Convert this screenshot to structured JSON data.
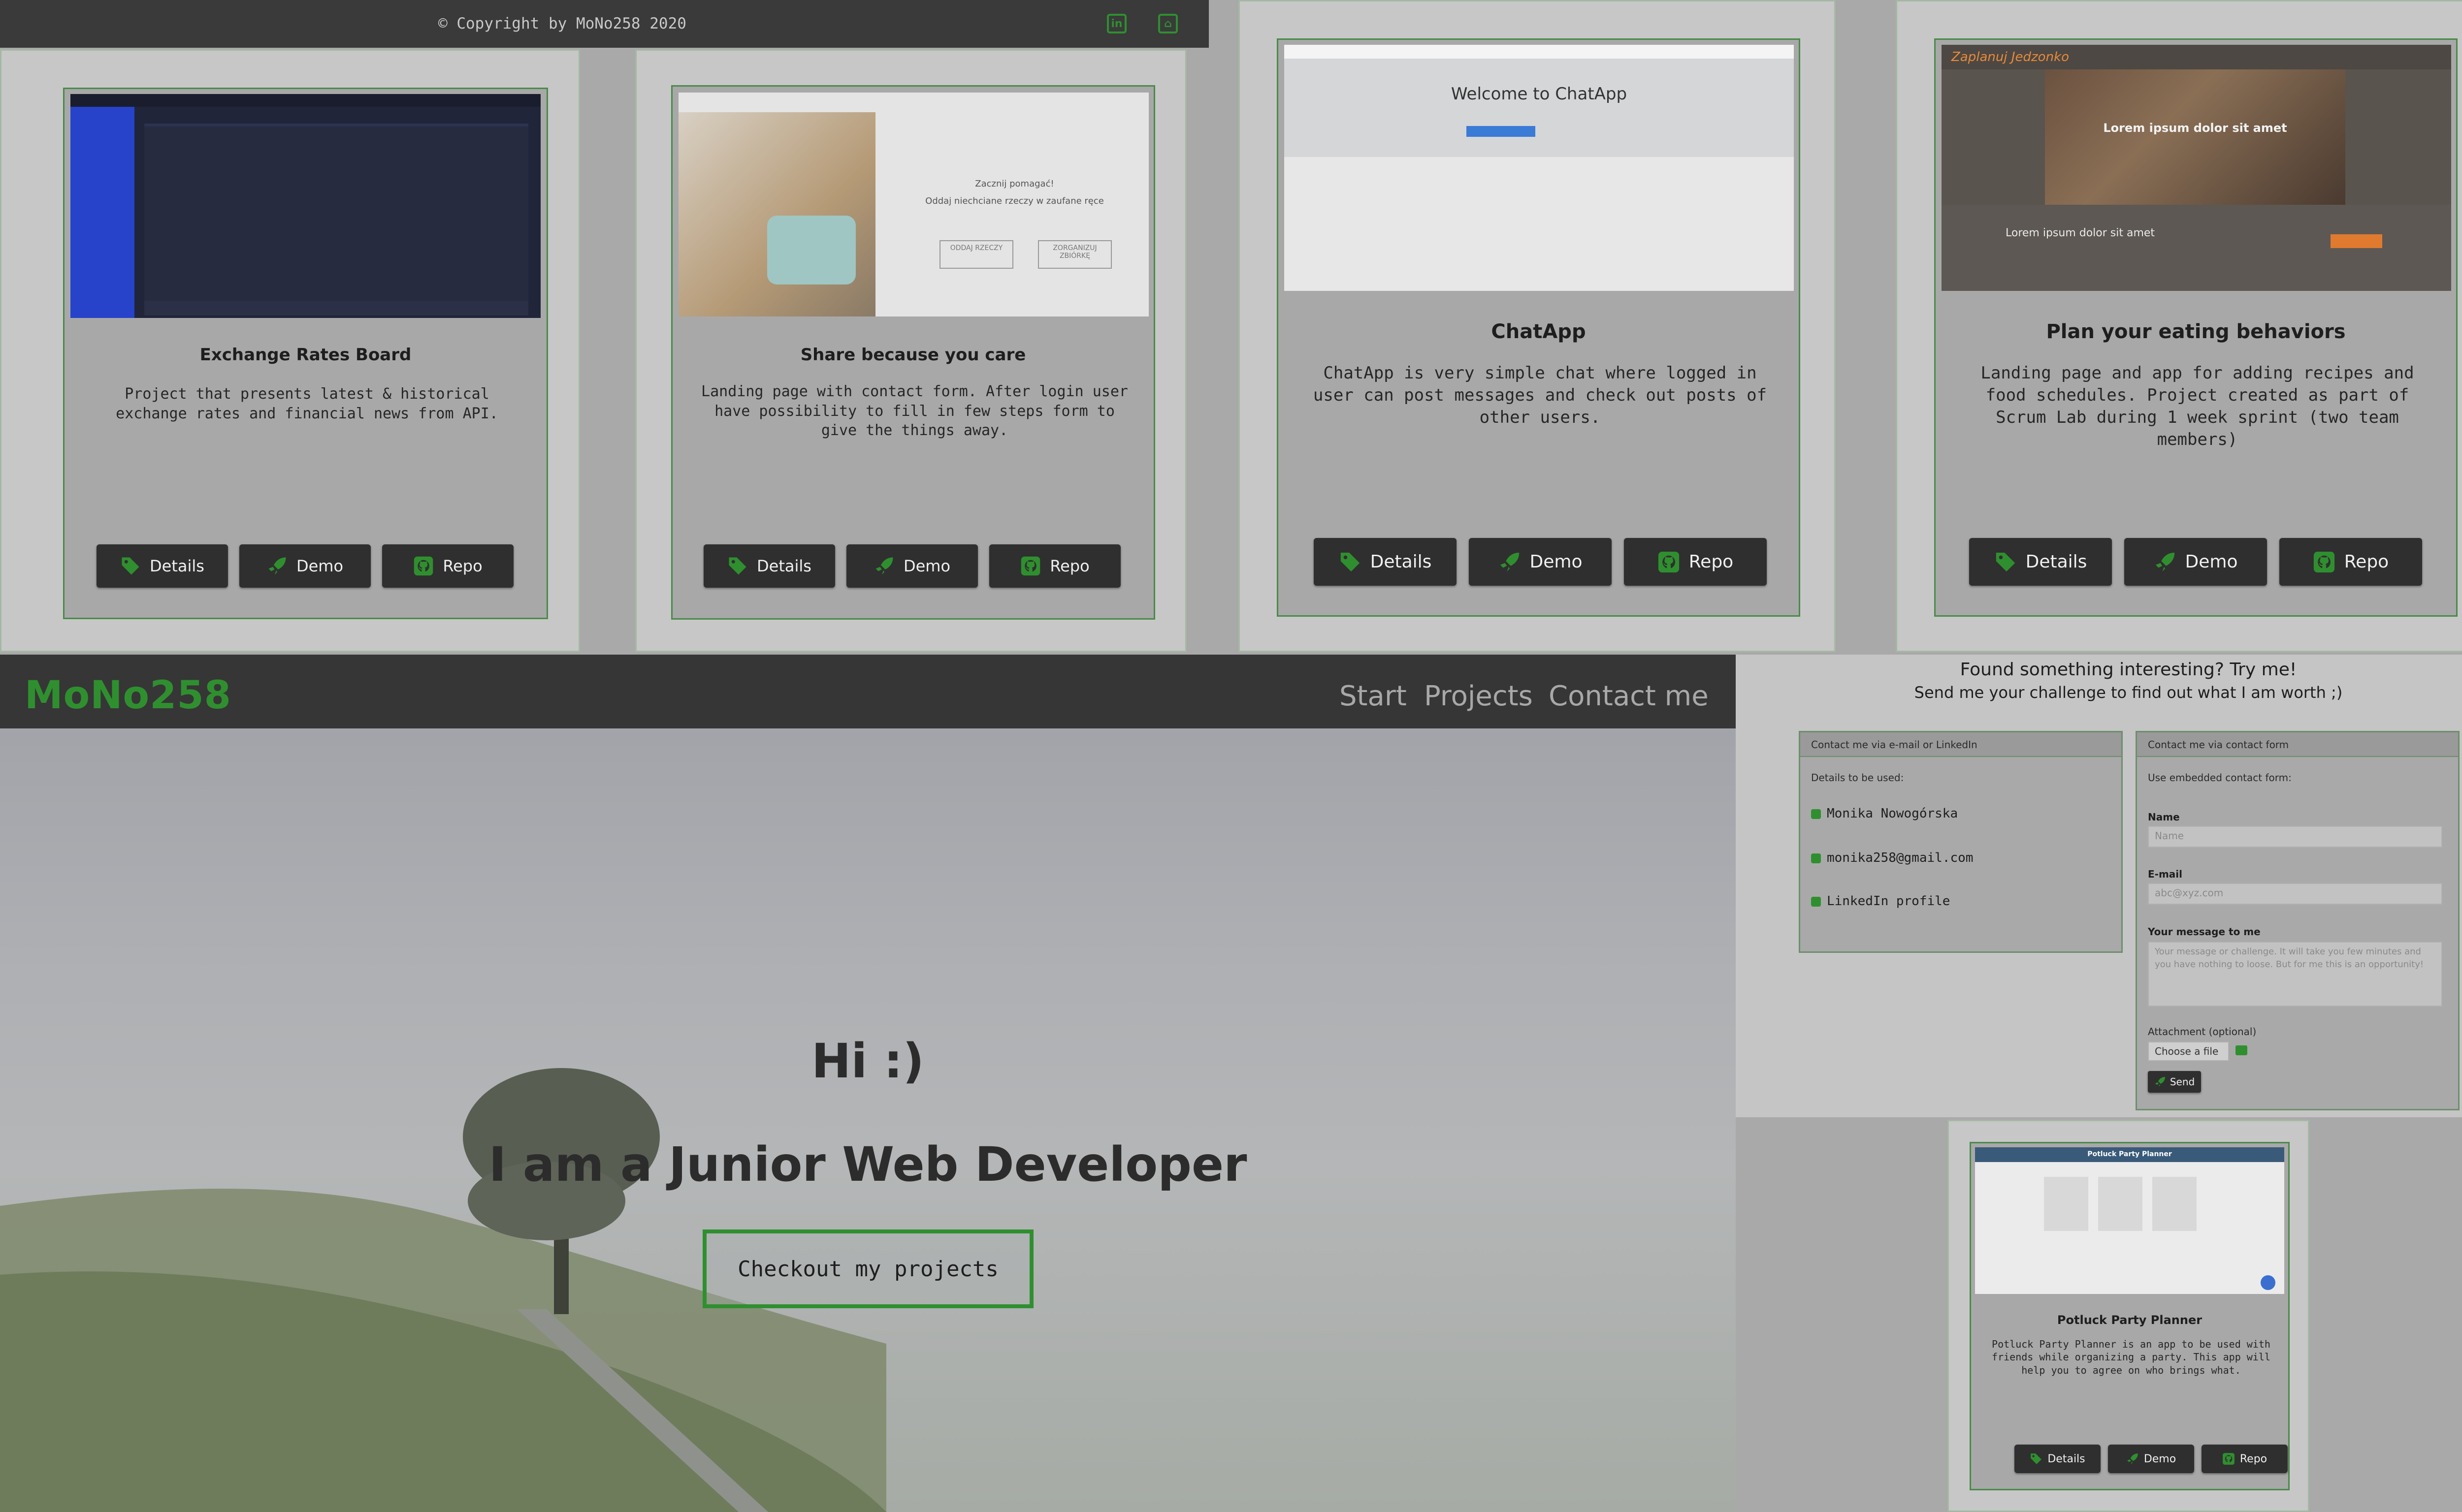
{
  "footer": {
    "copyright": "© Copyright by MoNo258 2020",
    "icons": [
      "linkedin-icon",
      "github-icon"
    ]
  },
  "buttons": {
    "details": "Details",
    "demo": "Demo",
    "repo": "Repo"
  },
  "projects": [
    {
      "title": "Exchange Rates Board",
      "description": "Project that presents latest & historical exchange rates and financial news from API."
    },
    {
      "title": "Share because you care",
      "description": "Landing page with contact form. After login user have possibility to fill in few steps form to give the things away.",
      "thumb": {
        "line1": "Zacznij pomagać!",
        "line2": "Oddaj niechciane rzeczy w zaufane ręce",
        "btn1": "ODDAJ RZECZY",
        "btn2": "ZORGANIZUJ ZBIÓRKĘ"
      }
    },
    {
      "title": "ChatApp",
      "description": "ChatApp is very simple chat where logged in user can post messages and check out posts of other users.",
      "thumb": {
        "heading": "Welcome to ChatApp"
      }
    },
    {
      "title": "Plan your eating behaviors",
      "description": "Landing page and app for adding recipes and food schedules. Project created as part of Scrum Lab during 1 week sprint (two team members)",
      "thumb": {
        "logo": "Zaplanuj Jedzonko",
        "hero": "Lorem ipsum dolor sit amet",
        "sub": "Lorem ipsum dolor sit amet"
      }
    },
    {
      "title": "Potluck Party Planner",
      "description": "Potluck Party Planner is an app to be used with friends while organizing a party. This app will help you to agree on who brings what.",
      "thumb": {
        "header": "Potluck Party Planner"
      }
    }
  ],
  "nav": {
    "brand": "MoNo258",
    "links": [
      "Start",
      "Projects",
      "Contact me"
    ]
  },
  "hero": {
    "greeting": "Hi :)",
    "role": "I am a Junior Web Developer",
    "cta": "Checkout my projects"
  },
  "contact": {
    "heading": "Found something interesting? Try me!",
    "subheading": "Send me your challenge to find out what I am worth ;)",
    "left": {
      "header": "Contact me via e-mail or LinkedIn",
      "intro": "Details to be used:",
      "name": "Monika Nowogórska",
      "email": "monika258@gmail.com",
      "linkedin": "LinkedIn profile"
    },
    "right": {
      "header": "Contact me via contact form",
      "intro": "Use embedded contact form:",
      "name_label": "Name",
      "name_placeholder": "Name",
      "email_label": "E-mail",
      "email_placeholder": "abc@xyz.com",
      "message_label": "Your message to me",
      "message_placeholder": "Your message or challenge. It will take you few minutes and you have nothing to loose. But for me this is an opportunity!",
      "attachment_label": "Attachment (optional)",
      "choose_file": "Choose a file",
      "send": "Send"
    }
  },
  "colors": {
    "accent": "#2f8f2f",
    "dark": "#363636",
    "panel": "#c7c7c7"
  }
}
